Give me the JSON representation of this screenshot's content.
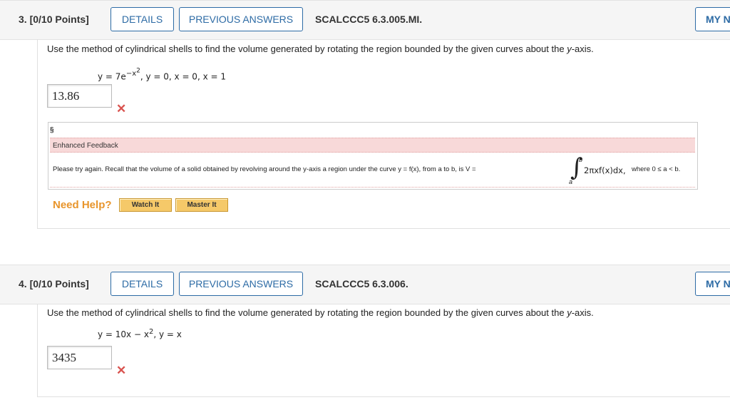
{
  "q3": {
    "number": "3. [0/10 Points]",
    "details": "DETAILS",
    "previous": "PREVIOUS ANSWERS",
    "code": "SCALCCC5 6.3.005.MI.",
    "my_notes": "MY NOTES",
    "prompt_start": "Use the method of cylindrical shells to find the volume generated by rotating the region bounded by the given curves about the ",
    "prompt_axis": "y",
    "prompt_end": "-axis.",
    "eq_main": "y = 7e",
    "eq_exp": "−x",
    "eq_exp2": "2",
    "eq_rest": ", y = 0, x = 0, x = 1",
    "answer": "13.86",
    "feedback_icon": "§",
    "feedback_title": "Enhanced Feedback",
    "feedback_text": "Please try again. Recall that the volume of a solid obtained by revolving around the y-axis a region under the curve y = f(x), from a to b, is V =",
    "integral_upper": "b",
    "integral_lower": "a",
    "integral_body": "2πxf(x)dx,",
    "integral_where": "where 0 ≤ a < b.",
    "need_help": "Need Help?",
    "watch_it": "Watch It",
    "master_it": "Master It"
  },
  "q4": {
    "number": "4. [0/10 Points]",
    "details": "DETAILS",
    "previous": "PREVIOUS ANSWERS",
    "code": "SCALCCC5 6.3.006.",
    "my_notes": "MY NOTES",
    "prompt_start": "Use the method of cylindrical shells to find the volume generated by rotating the region bounded by the given curves about the ",
    "prompt_axis": "y",
    "prompt_end": "-axis.",
    "eq_main": "y = 10x − x",
    "eq_exp": "2",
    "eq_rest": ",  y = x",
    "answer": "3435"
  },
  "icons": {
    "wrong": "cross-mark-icon"
  },
  "colors": {
    "link": "#2d6ba5",
    "wrong": "#d9534f",
    "need_help": "#e8952c",
    "feedback_bg": "#f8d9d9",
    "help_button": "#f5c969"
  }
}
